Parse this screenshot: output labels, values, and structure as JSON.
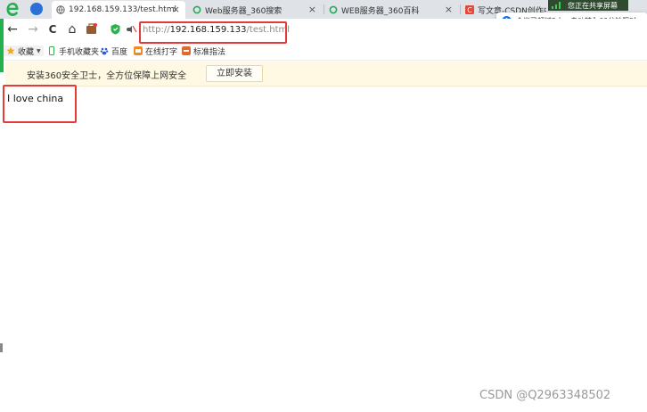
{
  "browser": {
    "tabs": [
      {
        "title": "192.168.159.133/test.html",
        "active": true
      },
      {
        "title": "Web服务器_360搜索",
        "active": false
      },
      {
        "title": "WEB服务器_360百科",
        "active": false
      },
      {
        "title": "写文章-CSDN创作中",
        "active": false
      }
    ],
    "close_glyph": "×"
  },
  "share": {
    "badge": "您正在共享屏幕",
    "notice": "会议已超过2人，自动转为60分钟限时"
  },
  "toolbar": {
    "back": "←",
    "forward": "→",
    "reload": "C",
    "home": "⌂",
    "address_scheme": "http://",
    "address_host": "192.168.159.133",
    "address_path": "/test.html"
  },
  "bookmarks": {
    "favorites": "收藏",
    "items": [
      "手机收藏夹",
      "百度",
      "在线打字",
      "标准指法"
    ]
  },
  "banner": {
    "message": "安装360安全卫士，全方位保障上网安全",
    "button": "立即安装"
  },
  "page": {
    "text": "I love china"
  },
  "watermark": "CSDN @Q2963348502",
  "colors": {
    "highlight": "#e53a3a",
    "tabbar": "#dfe3e8",
    "banner": "#fff9e3",
    "accent": "#22b14c"
  }
}
